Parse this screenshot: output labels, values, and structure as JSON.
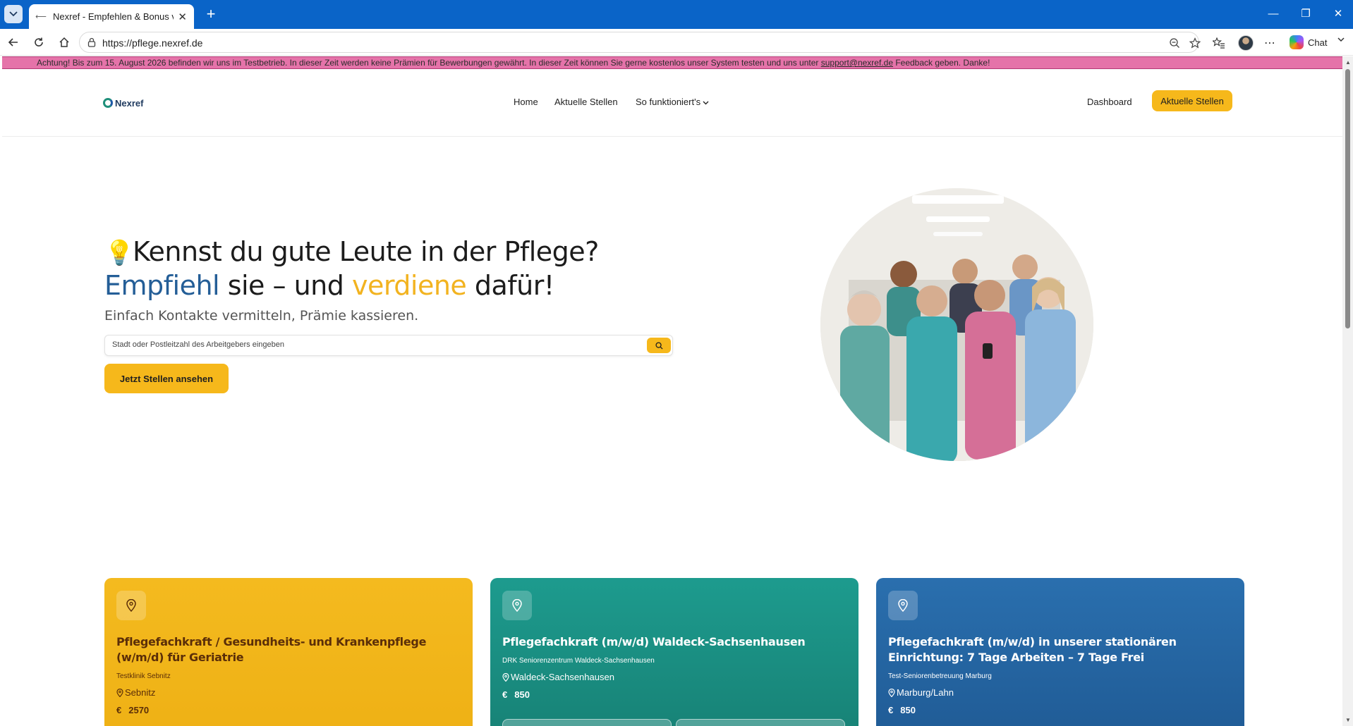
{
  "browser": {
    "tab_title": "Nexref - Empfehlen & Bonus verdienen",
    "url": "https://pflege.nexref.de",
    "chat_label": "Chat"
  },
  "notice": {
    "text_before": "Achtung! Bis zum 15. August 2026 befinden wir uns im Testbetrieb. In dieser Zeit werden keine Prämien für Bewerbungen gewährt. In dieser Zeit können Sie gerne kostenlos unser System testen und uns unter ",
    "email": "support@nexref.de",
    "text_after": " Feedback geben. Danke!"
  },
  "header": {
    "logo_text": "Nexref",
    "nav": {
      "home": "Home",
      "jobs": "Aktuelle Stellen",
      "how": "So funktioniert's",
      "dashboard": "Dashboard"
    },
    "cta_label": "Aktuelle Stellen"
  },
  "hero": {
    "bulb": "💡",
    "line1": "Kennst du gute Leute in der Pflege?",
    "word_empfiehl": "Empfiehl",
    "word_sie_und": " sie – und ",
    "word_verdiene": "verdiene",
    "word_dafuer": " dafür!",
    "subtitle": "Einfach Kontakte vermitteln, Prämie kassieren.",
    "search_placeholder": "Stadt oder Postleitzahl des Arbeitgebers eingeben",
    "cta_label": "Jetzt Stellen ansehen"
  },
  "jobs": [
    {
      "title": "Pflegefachkraft / Gesundheits- und Krankenpflege (w/m/d) für Geriatrie",
      "company": "Testklinik Sebnitz",
      "location": "Sebnitz",
      "currency": "€",
      "bonus": "2570",
      "color": "#f4ba1f"
    },
    {
      "title": "Pflegefachkraft (m/w/d) Waldeck-Sachsenhausen",
      "company": "DRK Seniorenzentrum Waldeck-Sachsenhausen",
      "location": "Waldeck-Sachsenhausen",
      "currency": "€",
      "bonus": "850",
      "color": "#1d9b8e"
    },
    {
      "title": "Pflegefachkraft (m/w/d) in unserer stationären Einrichtung: 7 Tage Arbeiten – 7 Tage Frei",
      "company": "Test-Seniorenbetreuung Marburg",
      "location": "Marburg/Lahn",
      "currency": "€",
      "bonus": "850",
      "color": "#2a6fae"
    }
  ],
  "icons": {
    "bulb": "lightbulb-icon",
    "pin": "map-pin-icon",
    "search": "search-icon",
    "chevron": "chevron-down-icon"
  }
}
